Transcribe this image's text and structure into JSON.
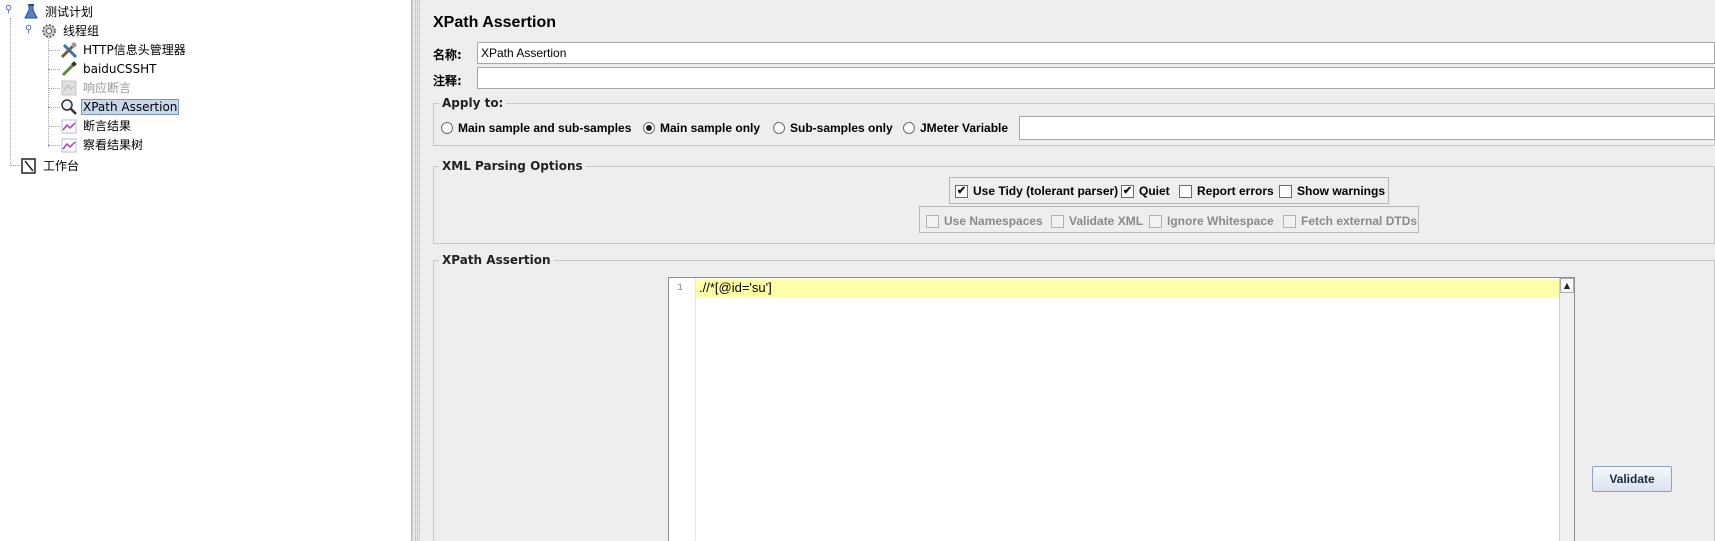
{
  "tree": {
    "root": "测试计划",
    "thread_group": "线程组",
    "items": [
      {
        "label": "HTTP信息头管理器"
      },
      {
        "label": "baiduCSSHT"
      },
      {
        "label": "响应断言"
      },
      {
        "label": "XPath Assertion"
      },
      {
        "label": "断言结果"
      },
      {
        "label": "察看结果树"
      }
    ],
    "workbench": "工作台"
  },
  "panel": {
    "title": "XPath Assertion",
    "name_label": "名称:",
    "name_value": "XPath Assertion",
    "comment_label": "注释:",
    "comment_value": ""
  },
  "apply_to": {
    "title": "Apply to:",
    "options": [
      {
        "label": "Main sample and sub-samples",
        "checked": false
      },
      {
        "label": "Main sample only",
        "checked": true
      },
      {
        "label": "Sub-samples only",
        "checked": false
      },
      {
        "label": "JMeter Variable",
        "checked": false
      }
    ],
    "variable_value": ""
  },
  "xml_options": {
    "title": "XML Parsing Options",
    "row1": [
      {
        "label": "Use Tidy (tolerant parser)",
        "checked": true
      },
      {
        "label": "Quiet",
        "checked": true
      },
      {
        "label": "Report errors",
        "checked": false
      },
      {
        "label": "Show warnings",
        "checked": false
      }
    ],
    "row2": [
      {
        "label": "Use Namespaces",
        "checked": false
      },
      {
        "label": "Validate XML",
        "checked": false
      },
      {
        "label": "Ignore Whitespace",
        "checked": false
      },
      {
        "label": "Fetch external DTDs",
        "checked": false
      }
    ]
  },
  "xpath": {
    "title": "XPath Assertion",
    "line_number": "1",
    "expression": ".//*[@id='su']",
    "validate_label": "Validate"
  }
}
